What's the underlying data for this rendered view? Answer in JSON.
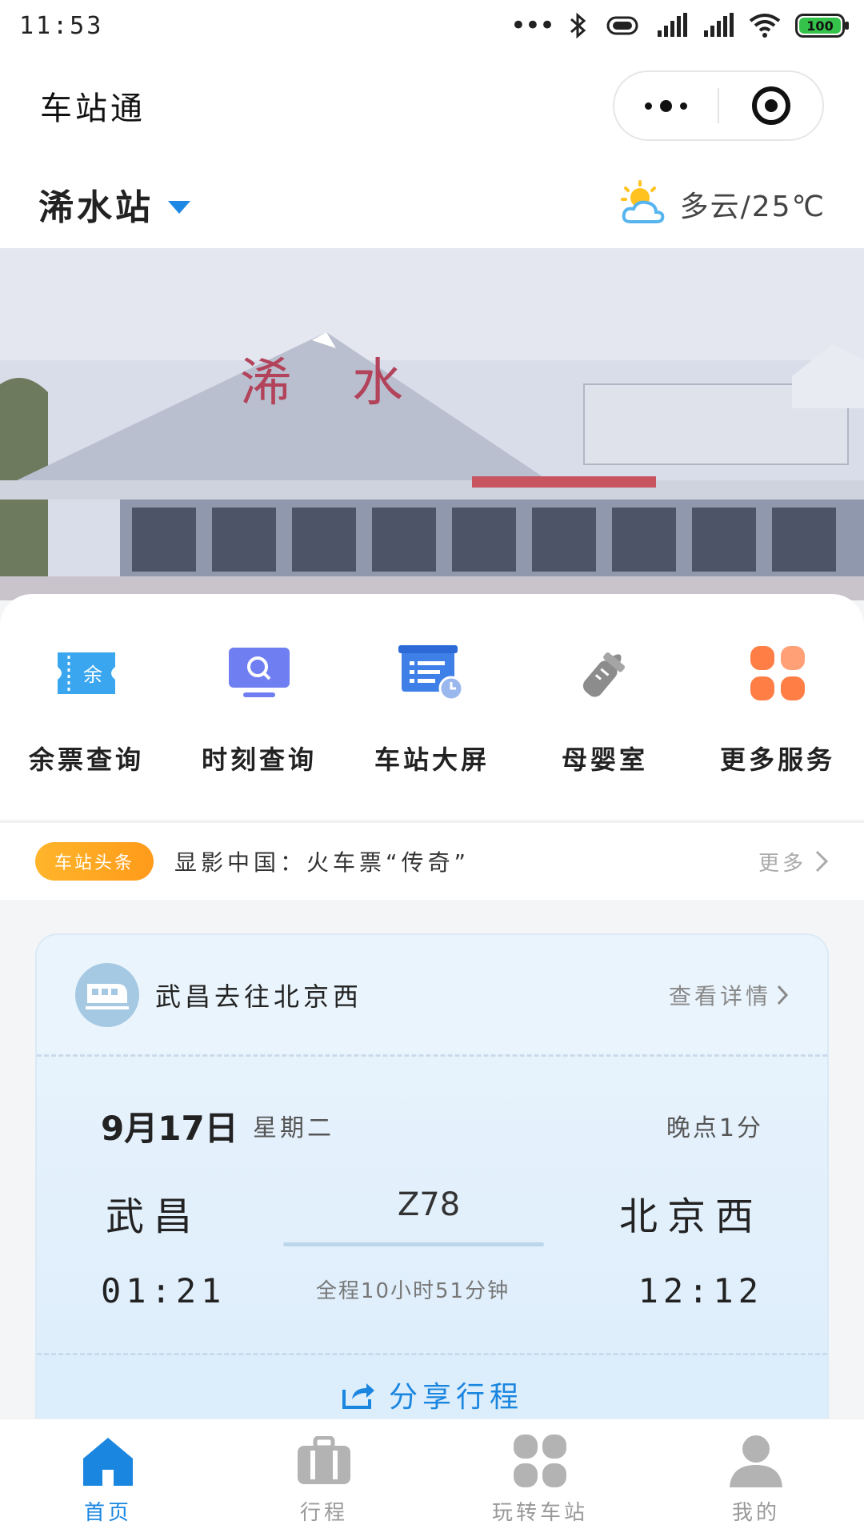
{
  "status_bar": {
    "time": "11:53",
    "battery": "100"
  },
  "title_bar": {
    "title": "车站通"
  },
  "station": {
    "name": "浠水站",
    "weather": "多云/25℃"
  },
  "services": [
    {
      "label": "余票查询",
      "icon": "ticket-icon",
      "icon_text": "余"
    },
    {
      "label": "时刻查询",
      "icon": "monitor-search-icon"
    },
    {
      "label": "车站大屏",
      "icon": "schedule-board-icon"
    },
    {
      "label": "母婴室",
      "icon": "baby-bottle-icon"
    },
    {
      "label": "更多服务",
      "icon": "grid-icon"
    }
  ],
  "news": {
    "tag": "车站头条",
    "headline": "显影中国：火车票“传奇”",
    "more": "更多"
  },
  "trip": {
    "route_title": "武昌去往北京西",
    "detail_link": "查看详情",
    "date": "9月17日",
    "weekday": "星期二",
    "delay": "晚点1分",
    "from": "武昌",
    "to": "北京西",
    "train_no": "Z78",
    "duration": "全程10小时51分钟",
    "depart_time": "01:21",
    "arrive_time": "12:12",
    "share": "分享行程"
  },
  "tabs": [
    {
      "label": "首页",
      "icon": "home-icon",
      "active": true
    },
    {
      "label": "行程",
      "icon": "briefcase-icon",
      "active": false
    },
    {
      "label": "玩转车站",
      "icon": "clover-icon",
      "active": false
    },
    {
      "label": "我的",
      "icon": "user-icon",
      "active": false
    }
  ],
  "colors": {
    "accent": "#1a86e0",
    "tag_orange": "#ffa726",
    "service_blue": "#3aa6ef",
    "service_purple": "#6f7ef0",
    "service_gray": "#8c8c8c",
    "service_orange": "#ff8a50"
  }
}
